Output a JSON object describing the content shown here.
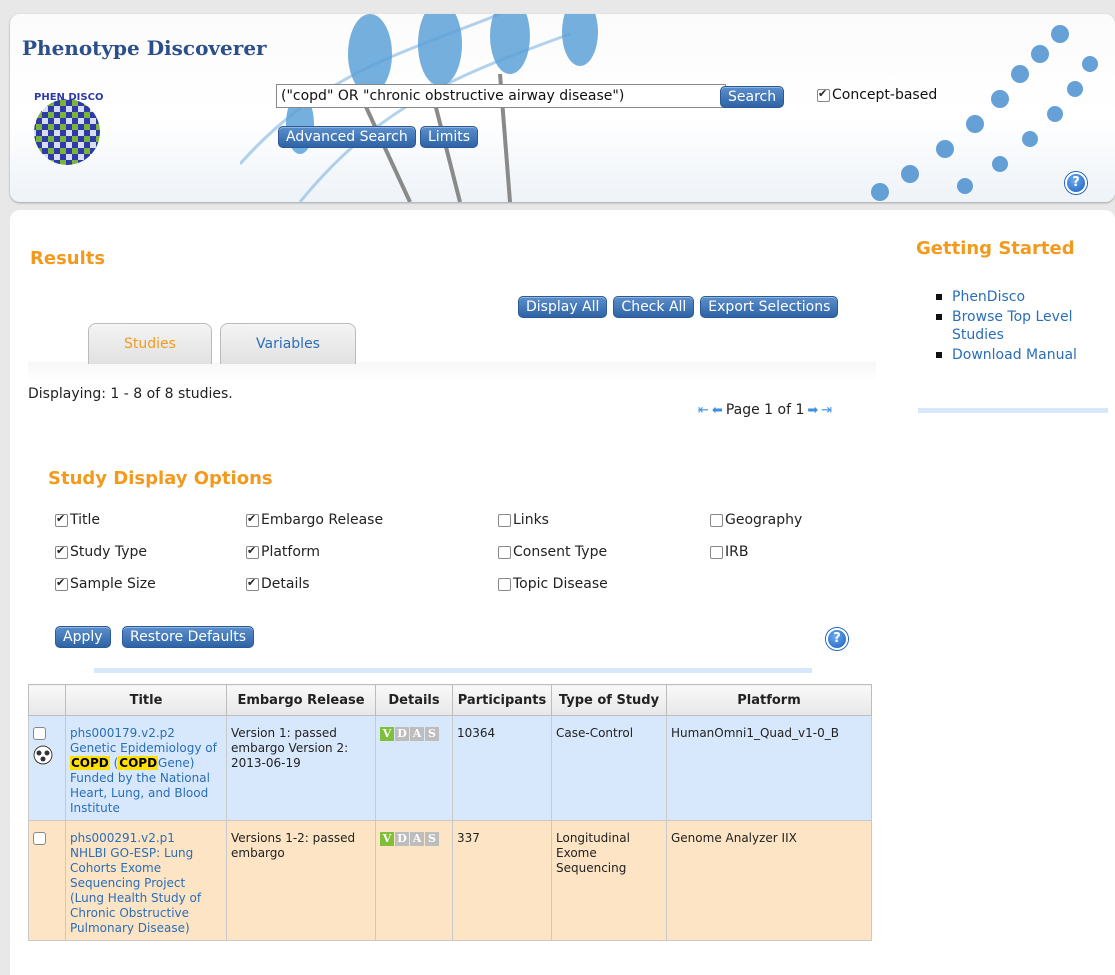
{
  "header": {
    "title": "Phenotype Discoverer",
    "logo_text": "PHEN DISCO",
    "search_value": "(\"copd\" OR \"chronic obstructive airway disease\")",
    "search_button": "Search",
    "concept_based_label": "Concept-based",
    "concept_based_checked": true,
    "advanced_search": "Advanced Search",
    "limits": "Limits",
    "help_icon": "?"
  },
  "results": {
    "heading": "Results",
    "actions": [
      "Display All",
      "Check All",
      "Export Selections"
    ],
    "tabs": [
      "Studies",
      "Variables"
    ],
    "active_tab": "Studies",
    "displaying": "Displaying: 1 - 8 of 8 studies.",
    "pager": "Page 1 of 1"
  },
  "getting_started": {
    "heading": "Getting Started",
    "links": [
      "PhenDisco",
      "Browse Top Level Studies",
      "Download Manual"
    ]
  },
  "display_options": {
    "heading": "Study Display Options",
    "options": [
      {
        "label": "Title",
        "checked": true
      },
      {
        "label": "Study Type",
        "checked": true
      },
      {
        "label": "Sample Size",
        "checked": true
      },
      {
        "label": "Embargo Release",
        "checked": true
      },
      {
        "label": "Platform",
        "checked": true
      },
      {
        "label": "Details",
        "checked": true
      },
      {
        "label": "Links",
        "checked": false
      },
      {
        "label": "Consent Type",
        "checked": false
      },
      {
        "label": "Topic Disease",
        "checked": false
      },
      {
        "label": "Geography",
        "checked": false
      },
      {
        "label": "IRB",
        "checked": false
      }
    ],
    "apply": "Apply",
    "restore": "Restore Defaults"
  },
  "table": {
    "columns": [
      "",
      "Title",
      "Embargo Release",
      "Details",
      "Participants",
      "Type of Study",
      "Platform"
    ],
    "details_badges": [
      "V",
      "D",
      "A",
      "S"
    ],
    "rows": [
      {
        "study_id": "phs000179.v2.p2",
        "title_pre": "Genetic Epidemiology of ",
        "title_hl1": "COPD",
        "title_mid": " (",
        "title_hl2": "COPD",
        "title_post": "Gene)",
        "funding": "Funded by the National Heart, Lung, and Blood Institute",
        "embargo": "Version 1: passed embargo Version 2: 2013-06-19",
        "participants": "10364",
        "type": "Case-Control",
        "platform": "HumanOmni1_Quad_v1-0_B"
      },
      {
        "study_id": "phs000291.v2.p1",
        "title": "NHLBI GO-ESP: Lung Cohorts Exome Sequencing Project (Lung Health Study of Chronic Obstructive Pulmonary Disease)",
        "embargo": "Versions 1-2: passed embargo",
        "participants": "337",
        "type": "Longitudinal Exome Sequencing",
        "platform": "Genome Analyzer IIX"
      }
    ]
  }
}
